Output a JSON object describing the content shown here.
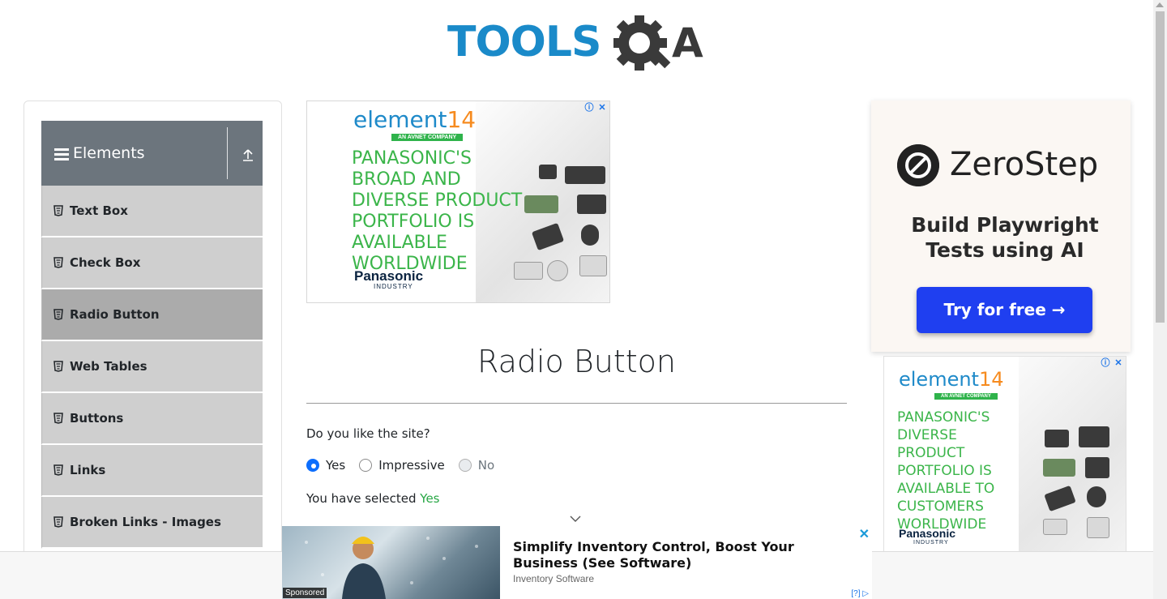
{
  "logo": {
    "text_left": "TOOLS",
    "text_right": "A"
  },
  "sidebar": {
    "group_title": "Elements",
    "items": [
      {
        "label": "Text Box",
        "active": false
      },
      {
        "label": "Check Box",
        "active": false
      },
      {
        "label": "Radio Button",
        "active": true
      },
      {
        "label": "Web Tables",
        "active": false
      },
      {
        "label": "Buttons",
        "active": false
      },
      {
        "label": "Links",
        "active": false
      },
      {
        "label": "Broken Links - Images",
        "active": false
      }
    ]
  },
  "ad_top": {
    "brand": "element",
    "brand_num": "14",
    "sub": "AN AVNET COMPANY",
    "copy": "PANASONIC'S BROAD AND DIVERSE PRODUCT PORTFOLIO IS AVAILABLE WORLDWIDE",
    "partner": "Panasonic",
    "partner_sub": "INDUSTRY"
  },
  "main": {
    "title": "Radio Button",
    "question": "Do you like the site?",
    "options": [
      {
        "label": "Yes",
        "checked": true,
        "disabled": false
      },
      {
        "label": "Impressive",
        "checked": false,
        "disabled": false
      },
      {
        "label": "No",
        "checked": false,
        "disabled": true
      }
    ],
    "result_prefix": "You have selected ",
    "result_value": "Yes"
  },
  "right_ad_1": {
    "name": "ZeroStep",
    "tagline": "Build Playwright Tests using AI",
    "cta": "Try for free →"
  },
  "right_ad_2": {
    "brand": "element",
    "brand_num": "14",
    "sub": "AN AVNET COMPANY",
    "copy": "PANASONIC'S DIVERSE PRODUCT PORTFOLIO IS AVAILABLE TO CUSTOMERS WORLDWIDE",
    "partner": "Panasonic",
    "partner_sub": "INDUSTRY"
  },
  "bottom_ad": {
    "badge": "Sponsored",
    "headline": "Simplify Inventory Control, Boost Your Business (See Software)",
    "source": "Inventory Software",
    "info": "[?]"
  },
  "colors": {
    "accent": "#0d6efd",
    "sidebar_header": "#6c757d",
    "success": "#28a745",
    "brand": "#1a8ac9"
  }
}
